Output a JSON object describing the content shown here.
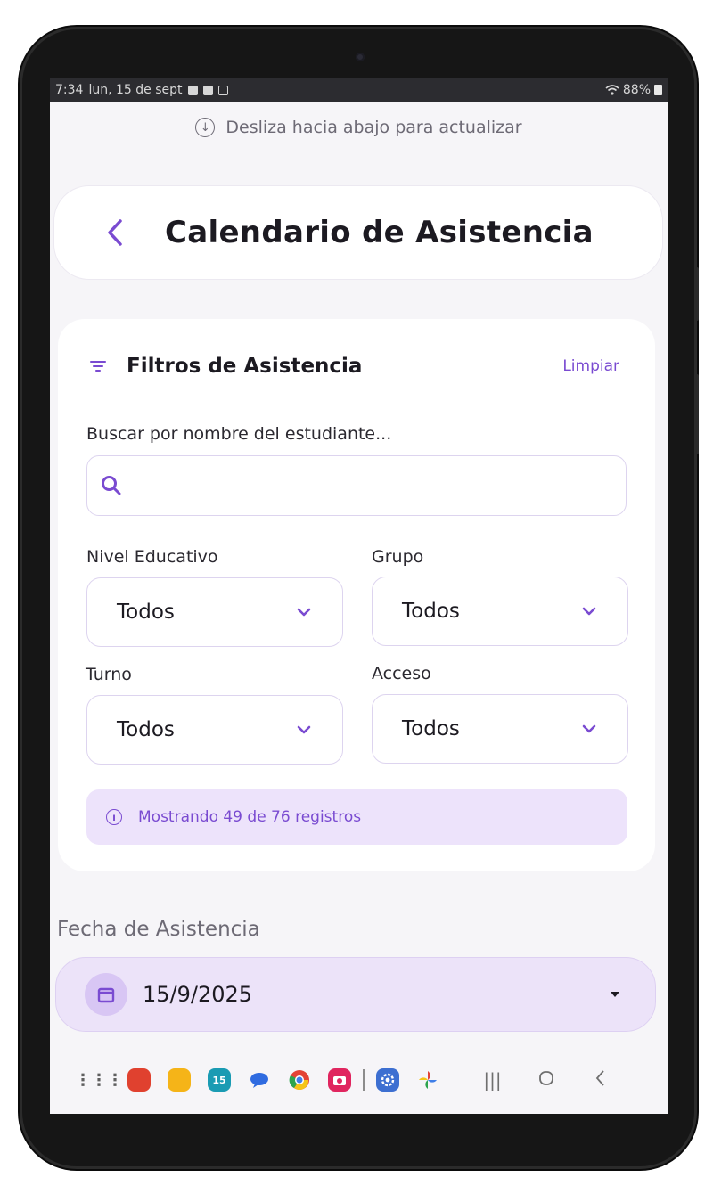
{
  "status_bar": {
    "time": "7:34",
    "date": "lun, 15 de sept",
    "battery": "88%"
  },
  "refresh_hint": "Desliza hacia abajo para actualizar",
  "header": {
    "title": "Calendario de Asistencia"
  },
  "filters": {
    "title": "Filtros de Asistencia",
    "clear_label": "Limpiar",
    "search": {
      "label": "Buscar por nombre del estudiante...",
      "value": ""
    },
    "nivel": {
      "label": "Nivel Educativo",
      "value": "Todos"
    },
    "grupo": {
      "label": "Grupo",
      "value": "Todos"
    },
    "turno": {
      "label": "Turno",
      "value": "Todos"
    },
    "acceso": {
      "label": "Acceso",
      "value": "Todos"
    },
    "summary": "Mostrando 49 de 76 registros"
  },
  "date": {
    "label": "Fecha de Asistencia",
    "value": "15/9/2025"
  },
  "nav": {
    "apps": [
      {
        "name": "apps-grid-icon",
        "color": "#5f5f5f"
      },
      {
        "name": "flipboard-app-icon",
        "color": "#e0412f"
      },
      {
        "name": "notes-app-icon",
        "color": "#f5b418"
      },
      {
        "name": "calendar-app-icon",
        "color": "#1a9bb3",
        "text": "15"
      },
      {
        "name": "messages-app-icon",
        "color": "#2f6be0"
      },
      {
        "name": "chrome-app-icon",
        "color": "#e34335"
      },
      {
        "name": "camera-app-icon",
        "color": "#e0255f"
      },
      {
        "name": "settings-app-icon",
        "color": "#3d6fd1"
      },
      {
        "name": "photos-app-icon",
        "color": "#f2b51c"
      }
    ]
  },
  "colors": {
    "accent": "#7a4bd1",
    "accent_soft": "#ede3fb",
    "background": "#f6f5f8"
  }
}
